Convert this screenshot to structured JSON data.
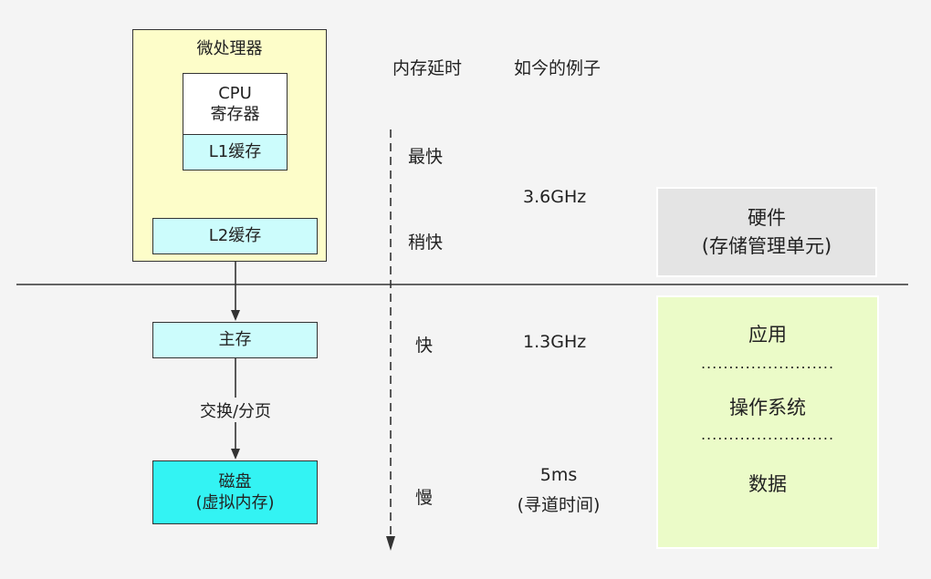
{
  "microprocessor": {
    "title": "微处理器",
    "cpu_line1": "CPU",
    "cpu_line2": "寄存器",
    "l1": "L1缓存",
    "l2": "L2缓存"
  },
  "memory": {
    "main": "主存",
    "swap_label": "交换/分页",
    "disk_line1": "磁盘",
    "disk_line2": "(虚拟内存)"
  },
  "headers": {
    "latency": "内存延时",
    "example": "如今的例子"
  },
  "speeds": [
    "最快",
    "稍快",
    "快",
    "慢"
  ],
  "examples": {
    "cache_freq": "3.6GHz",
    "main_freq": "1.3GHz",
    "disk_line1": "5ms",
    "disk_line2": "(寻道时间)"
  },
  "hardware_box": {
    "line1": "硬件",
    "line2": "(存储管理单元)"
  },
  "software_box": {
    "app": "应用",
    "os": "操作系统",
    "data": "数据",
    "divider": "........................"
  },
  "colors": {
    "background": "#f4f4f4",
    "processor_fill": "#fdfdc9",
    "cache_fill": "#ccfcfc",
    "disk_fill": "#33f3f3",
    "hardware_fill": "#e4e4e4",
    "software_fill": "#ebfbc8"
  }
}
